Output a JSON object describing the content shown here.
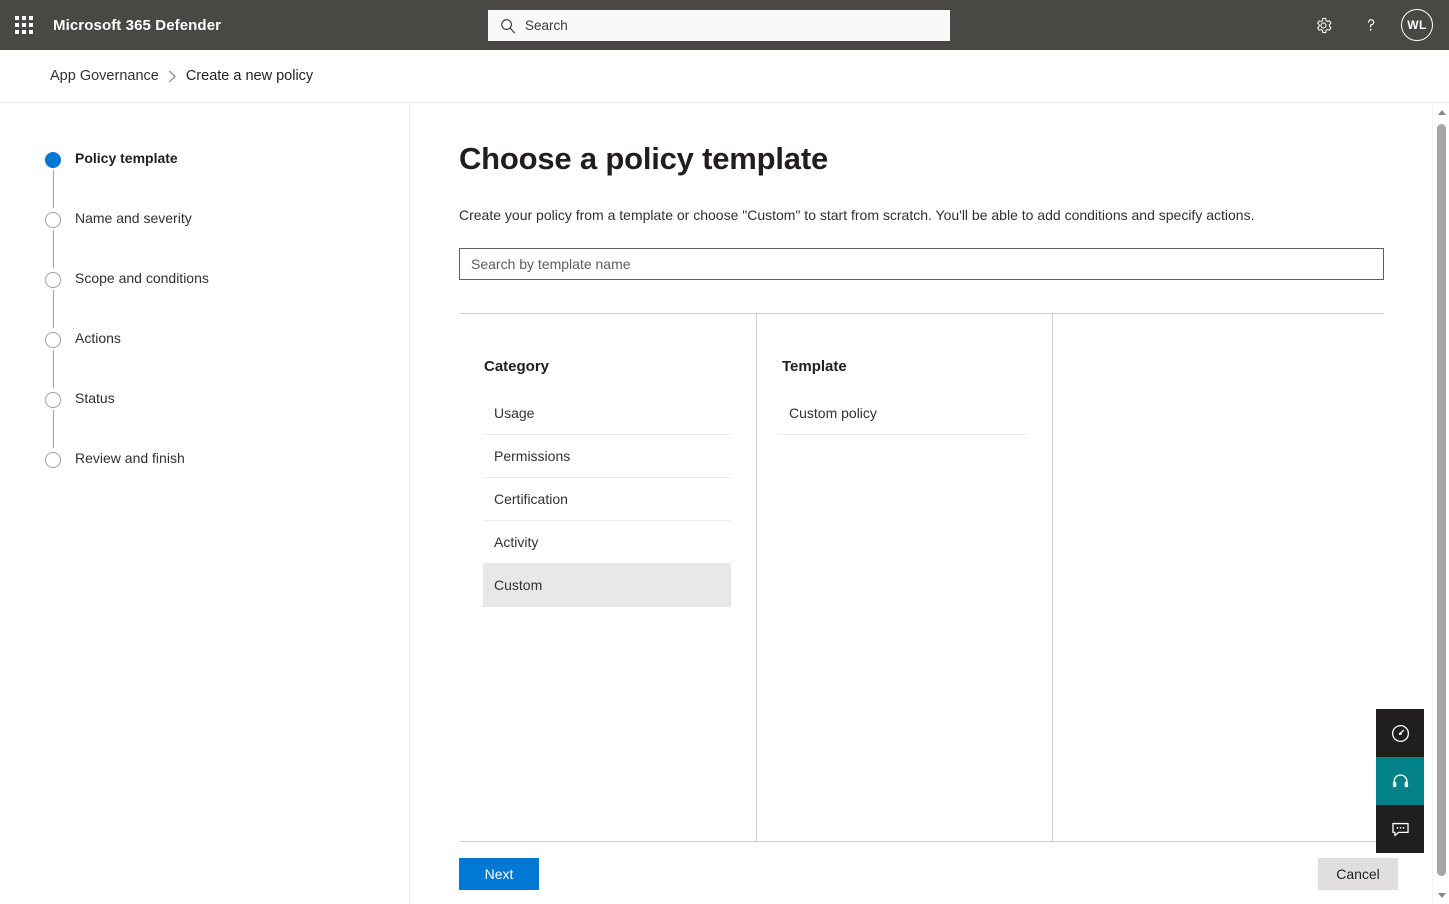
{
  "suite": {
    "title": "Microsoft 365 Defender",
    "waffle_name": "app-launcher-icon",
    "search_placeholder": "Search",
    "settings_label": "Settings",
    "help_label": "Help",
    "avatar_initials": "WL",
    "colors": {
      "bar_bg": "#4a4844",
      "search_bg": "#f9f9f9"
    }
  },
  "breadcrumb": {
    "items": [
      {
        "label": "App Governance"
      },
      {
        "label": "Create a new policy"
      }
    ],
    "separator": "›"
  },
  "wizard": {
    "steps": [
      {
        "label": "Policy template",
        "state": "active"
      },
      {
        "label": "Name and severity",
        "state": "pending"
      },
      {
        "label": "Scope and conditions",
        "state": "pending"
      },
      {
        "label": "Actions",
        "state": "pending"
      },
      {
        "label": "Status",
        "state": "pending"
      },
      {
        "label": "Review and finish",
        "state": "pending"
      }
    ],
    "active_color": "#0078d4"
  },
  "main": {
    "title": "Choose a policy template",
    "description": "Create your policy from a template or choose \"Custom\" to start from scratch. You'll be able to add conditions and specify actions.",
    "search_placeholder": "Search by template name",
    "search_value": "",
    "category": {
      "heading": "Category",
      "items": [
        {
          "label": "Usage",
          "selected": false
        },
        {
          "label": "Permissions",
          "selected": false
        },
        {
          "label": "Certification",
          "selected": false
        },
        {
          "label": "Activity",
          "selected": false
        },
        {
          "label": "Custom",
          "selected": true
        }
      ]
    },
    "template": {
      "heading": "Template",
      "items": [
        {
          "label": "Custom policy",
          "selected": false
        }
      ]
    }
  },
  "footer": {
    "next_label": "Next",
    "cancel_label": "Cancel",
    "primary_color": "#0078d4",
    "secondary_color": "#e1dfdd"
  },
  "widgets": [
    {
      "name": "dashboard-gauge-icon",
      "style": "dark"
    },
    {
      "name": "support-headset-icon",
      "style": "teal"
    },
    {
      "name": "feedback-chat-icon",
      "style": "dark"
    }
  ]
}
